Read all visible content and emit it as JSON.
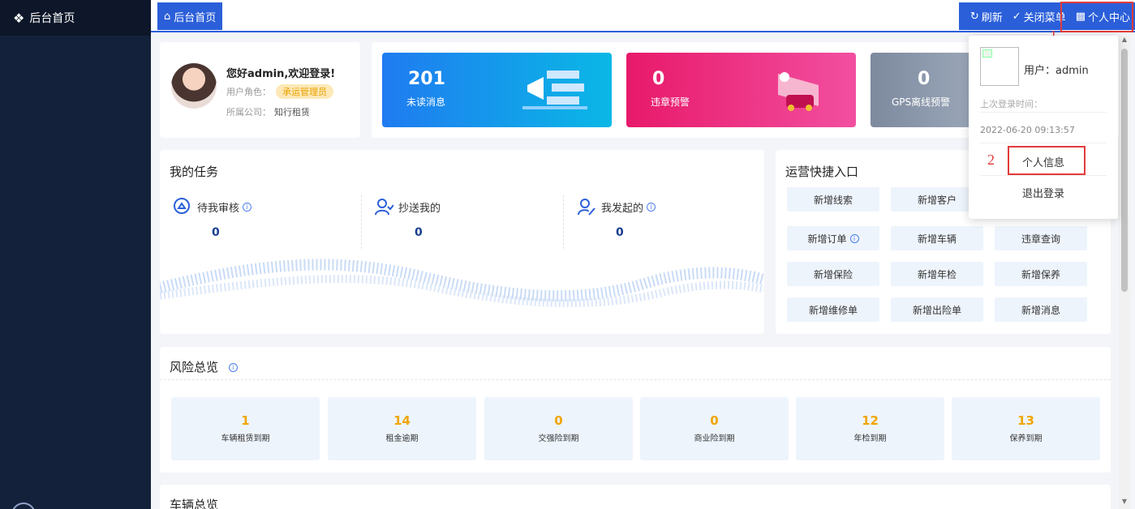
{
  "sidebar": {
    "title": "后台首页",
    "icon": "home-icon"
  },
  "topbar": {
    "tab_home": "后台首页",
    "actions": {
      "refresh": "刷新",
      "close_menu": "关闭菜单",
      "personal_center": "个人中心"
    }
  },
  "welcome": {
    "greeting": "您好admin,欢迎登录!",
    "role_label": "用户角色：",
    "role_value": "承运管理员",
    "company_label": "所属公司：",
    "company_value": "知行租赁"
  },
  "stats": [
    {
      "value": "201",
      "label": "未读消息",
      "color": "#1f7bf0"
    },
    {
      "value": "0",
      "label": "违章预警",
      "color": "#e8196a"
    },
    {
      "value": "0",
      "label": "GPS离线预警",
      "color": "#7d8a9e"
    }
  ],
  "tasks": {
    "title": "我的任务",
    "items": [
      {
        "label": "待我审核",
        "value": "0",
        "icon": "review-icon"
      },
      {
        "label": "抄送我的",
        "value": "0",
        "icon": "cc-user-icon"
      },
      {
        "label": "我发起的",
        "value": "0",
        "icon": "edit-user-icon"
      }
    ]
  },
  "quick": {
    "title": "运营快捷入口",
    "buttons": [
      "新增线索",
      "新增客户",
      "新增订单",
      "新增车辆",
      "违章查询",
      "新增保险",
      "新增年检",
      "新增保养",
      "新增维修单",
      "新增出险单",
      "新增消息"
    ]
  },
  "risk": {
    "title": "风险总览",
    "items": [
      {
        "value": "1",
        "label": "车辆租赁到期"
      },
      {
        "value": "14",
        "label": "租金逾期"
      },
      {
        "value": "0",
        "label": "交强险到期"
      },
      {
        "value": "0",
        "label": "商业险到期"
      },
      {
        "value": "12",
        "label": "年检到期"
      },
      {
        "value": "13",
        "label": "保养到期"
      }
    ]
  },
  "vehicle": {
    "title": "车辆总览"
  },
  "dropdown": {
    "user": "用户：admin",
    "last_login_label": "上次登录时间：",
    "last_login_time": "2022-06-20 09:13:57",
    "personal_info": "个人信息",
    "logout": "退出登录"
  },
  "annotations": {
    "one": "1",
    "two": "2"
  }
}
